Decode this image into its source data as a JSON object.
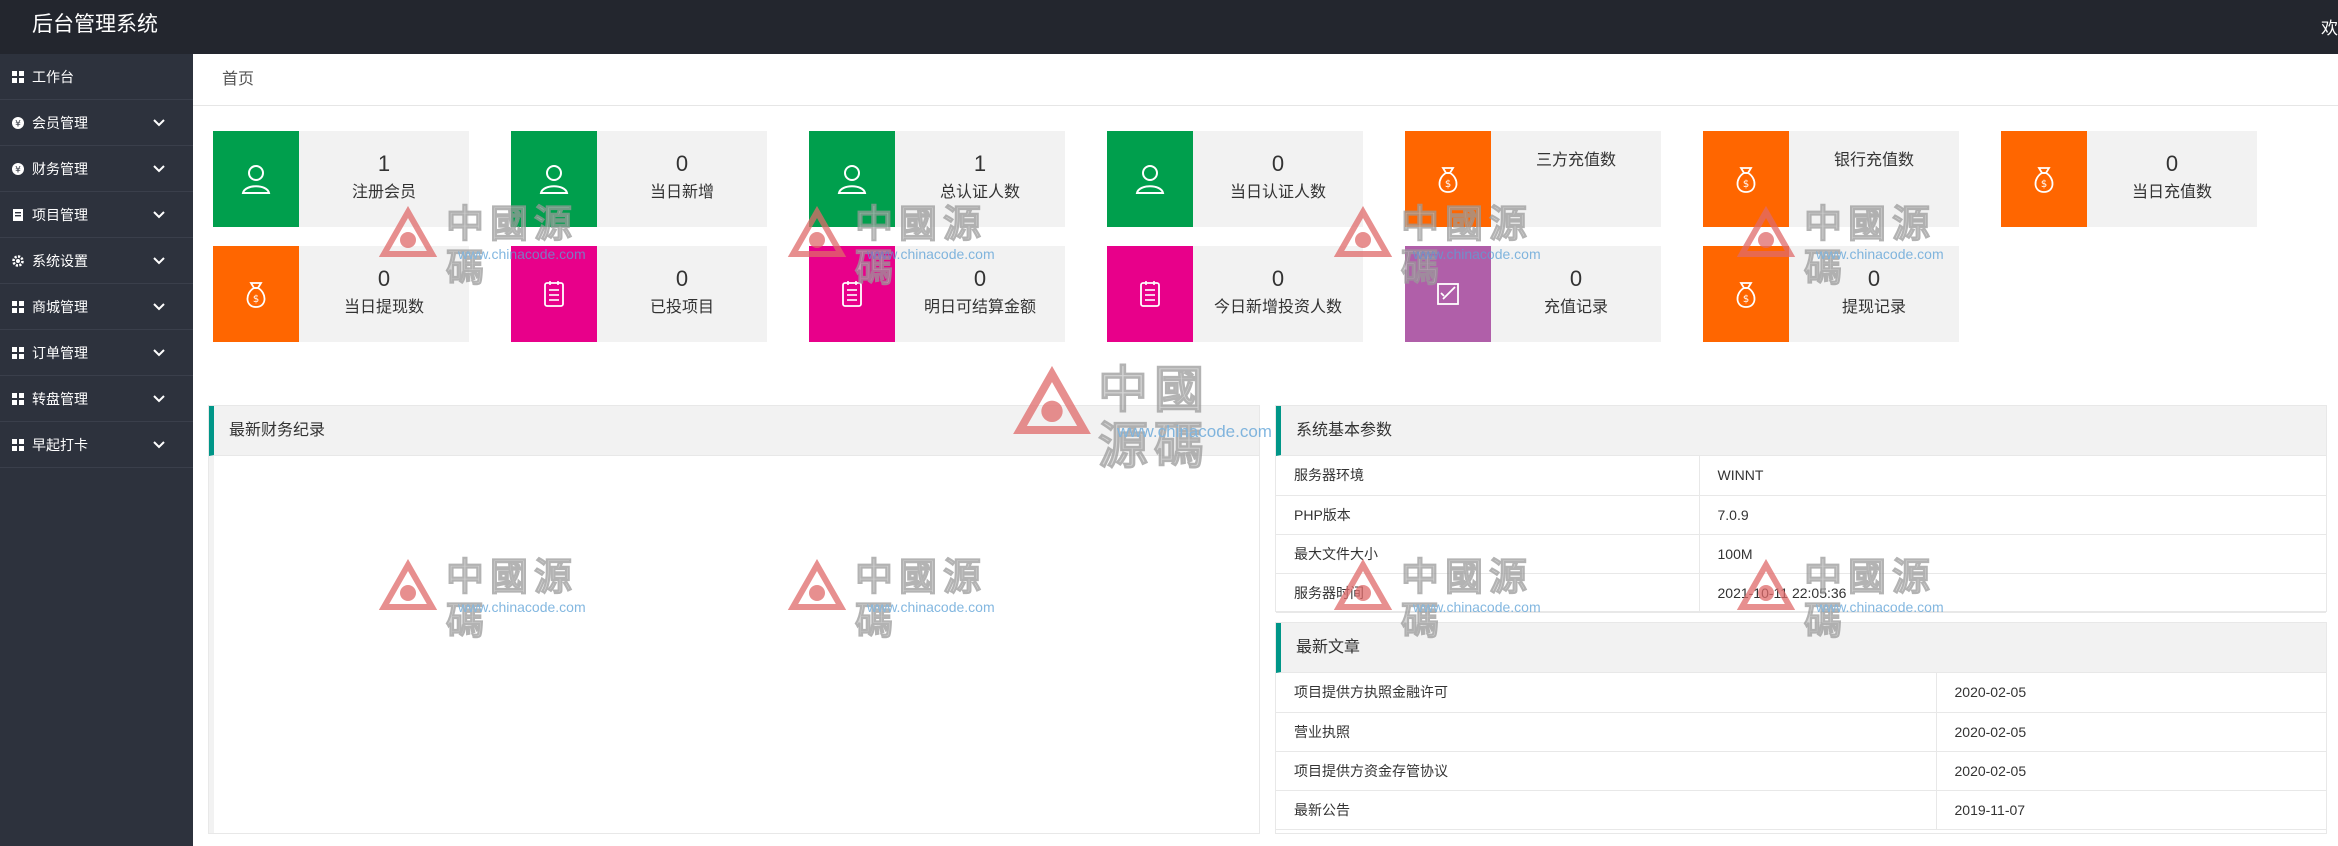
{
  "header": {
    "title": "后台管理系统",
    "corner": "欢"
  },
  "sidebar": {
    "items": [
      {
        "label": "工作台",
        "icon": "dashboard-icon",
        "has_arrow": false
      },
      {
        "label": "会员管理",
        "icon": "member-icon",
        "has_arrow": true
      },
      {
        "label": "财务管理",
        "icon": "finance-icon",
        "has_arrow": true
      },
      {
        "label": "项目管理",
        "icon": "project-icon",
        "has_arrow": true
      },
      {
        "label": "系统设置",
        "icon": "gear-icon",
        "has_arrow": true
      },
      {
        "label": "商城管理",
        "icon": "mall-icon",
        "has_arrow": true
      },
      {
        "label": "订单管理",
        "icon": "order-icon",
        "has_arrow": true
      },
      {
        "label": "转盘管理",
        "icon": "wheel-icon",
        "has_arrow": true
      },
      {
        "label": "早起打卡",
        "icon": "clock-in-icon",
        "has_arrow": true
      }
    ]
  },
  "breadcrumb": "首页",
  "cards": [
    {
      "value": "1",
      "label": "注册会员",
      "color": "#009f4d",
      "icon": "user-icon"
    },
    {
      "value": "0",
      "label": "当日新增",
      "color": "#009f4d",
      "icon": "user-icon"
    },
    {
      "value": "1",
      "label": "总认证人数",
      "color": "#009f4d",
      "icon": "user-icon"
    },
    {
      "value": "0",
      "label": "当日认证人数",
      "color": "#009f4d",
      "icon": "user-icon"
    },
    {
      "value": "",
      "label": "三方充值数",
      "color": "#ff6600",
      "icon": "money-bag-icon"
    },
    {
      "value": "",
      "label": "银行充值数",
      "color": "#ff6600",
      "icon": "money-bag-icon"
    },
    {
      "value": "0",
      "label": "当日充值数",
      "color": "#ff6600",
      "icon": "money-bag-icon"
    },
    {
      "value": "0",
      "label": "当日提现数",
      "color": "#ff6600",
      "icon": "money-bag-icon"
    },
    {
      "value": "0",
      "label": "已投项目",
      "color": "#e8008a",
      "icon": "document-icon"
    },
    {
      "value": "0",
      "label": "明日可结算金额",
      "color": "#e8008a",
      "icon": "document-icon"
    },
    {
      "value": "0",
      "label": "今日新增投资人数",
      "color": "#e8008a",
      "icon": "document-icon"
    },
    {
      "value": "0",
      "label": "充值记录",
      "color": "#b05fa9",
      "icon": "edit-icon"
    },
    {
      "value": "0",
      "label": "提现记录",
      "color": "#ff6600",
      "icon": "money-bag-icon"
    }
  ],
  "finance_panel": {
    "title": "最新财务纪录"
  },
  "system_panel": {
    "title": "系统基本参数",
    "rows": [
      {
        "key": "服务器环境",
        "value": "WINNT"
      },
      {
        "key": "PHP版本",
        "value": "7.0.9"
      },
      {
        "key": "最大文件大小",
        "value": "100M"
      },
      {
        "key": "服务器时间",
        "value": "2021-10-11 22:05:36"
      }
    ]
  },
  "articles_panel": {
    "title": "最新文章",
    "rows": [
      {
        "title": "项目提供方执照金融许可",
        "date": "2020-02-05"
      },
      {
        "title": "营业执照",
        "date": "2020-02-05"
      },
      {
        "title": "项目提供方资金存管协议",
        "date": "2020-02-05"
      },
      {
        "title": "最新公告",
        "date": "2019-11-07"
      }
    ]
  },
  "watermark": {
    "text": "中國源碼",
    "url": "www.chinacode.com"
  }
}
